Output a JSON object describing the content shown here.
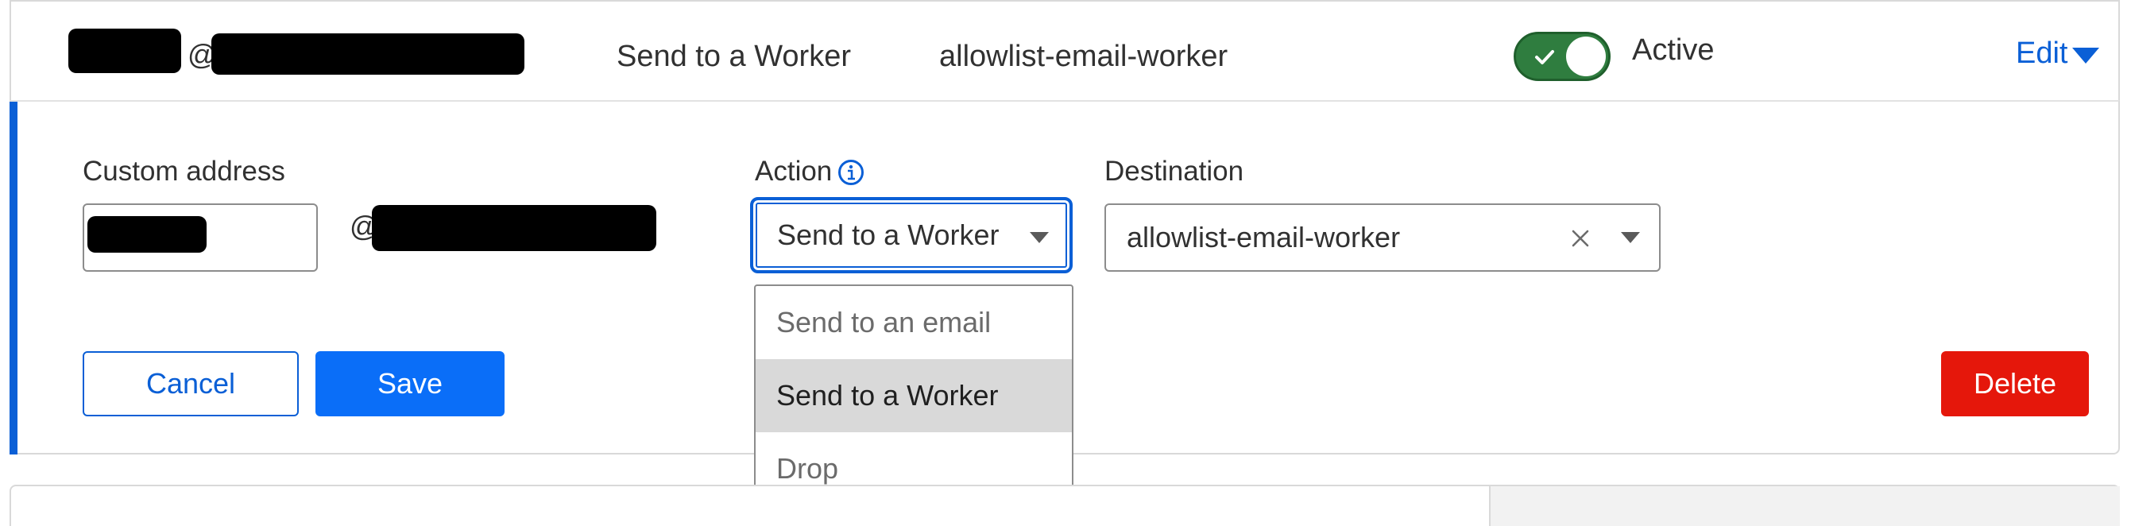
{
  "summary": {
    "at_symbol": "@",
    "action": "Send to a Worker",
    "destination": "allowlist-email-worker",
    "status": "Active",
    "status_on": true,
    "edit_label": "Edit"
  },
  "form": {
    "custom_address_label": "Custom address",
    "at_symbol": "@",
    "action_label": "Action",
    "action_value": "Send to a Worker",
    "destination_label": "Destination",
    "destination_value": "allowlist-email-worker",
    "action_options": [
      {
        "label": "Send to an email",
        "selected": false
      },
      {
        "label": "Send to a Worker",
        "selected": true
      },
      {
        "label": "Drop",
        "selected": false
      }
    ],
    "cancel_label": "Cancel",
    "save_label": "Save",
    "delete_label": "Delete"
  },
  "colors": {
    "accent": "#0a5fd6",
    "save": "#0a6ef8",
    "delete": "#e5170b",
    "toggle_on": "#2f7d3f"
  },
  "icons": {
    "toggle_check": "check-icon",
    "action_info": "info-icon",
    "clear": "close-icon",
    "dropdown": "chevron-down-icon",
    "edit_caret": "caret-down-icon"
  }
}
